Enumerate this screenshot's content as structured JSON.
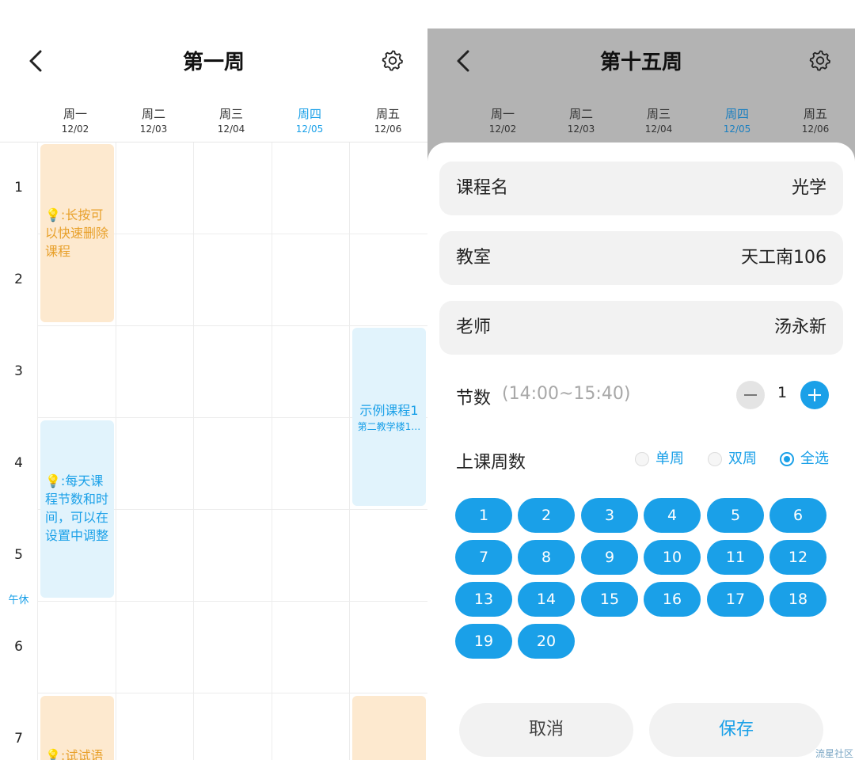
{
  "left": {
    "title": "第一周",
    "days": [
      {
        "name": "周一",
        "date": "12/02",
        "today": false
      },
      {
        "name": "周二",
        "date": "12/03",
        "today": false
      },
      {
        "name": "周三",
        "date": "12/04",
        "today": false
      },
      {
        "name": "周四",
        "date": "12/05",
        "today": true
      },
      {
        "name": "周五",
        "date": "12/06",
        "today": false
      }
    ],
    "sections": [
      "1",
      "2",
      "3",
      "4",
      "5",
      "6",
      "7"
    ],
    "noon_label": "午休",
    "cards": [
      {
        "text": "💡:长按可以快速删除课程",
        "color": "orange"
      },
      {
        "text": "💡:每天课程节数和时间，可以在设置中调整",
        "color": "blue"
      },
      {
        "text": "示例课程1",
        "subtext": "第二教学楼1…",
        "color": "blue"
      },
      {
        "text": "💡:试试语",
        "color": "orange"
      },
      {
        "text": "",
        "color": "orange"
      }
    ]
  },
  "right": {
    "title": "第十五周",
    "days": [
      {
        "name": "周一",
        "date": "12/02",
        "today": false
      },
      {
        "name": "周二",
        "date": "12/03",
        "today": false
      },
      {
        "name": "周三",
        "date": "12/04",
        "today": false
      },
      {
        "name": "周四",
        "date": "12/05",
        "today": true
      },
      {
        "name": "周五",
        "date": "12/06",
        "today": false
      }
    ],
    "form": {
      "course_label": "课程名",
      "course_value": "光学",
      "room_label": "教室",
      "room_value": "天工南106",
      "teacher_label": "老师",
      "teacher_value": "汤永新",
      "sections_label": "节数",
      "sections_time": "(14:00~15:40)",
      "sections_value": "1",
      "weeks_label": "上课周数",
      "radio_odd": "单周",
      "radio_even": "双周",
      "radio_all": "全选",
      "selected_radio": "全选",
      "weeks": [
        "1",
        "2",
        "3",
        "4",
        "5",
        "6",
        "7",
        "8",
        "9",
        "10",
        "11",
        "12",
        "13",
        "14",
        "15",
        "16",
        "17",
        "18",
        "19",
        "20"
      ],
      "cancel_label": "取消",
      "save_label": "保存"
    },
    "watermark": "流星社区"
  },
  "colors": {
    "accent": "#1aa0e8",
    "orange_card_bg": "#fde9cf",
    "orange_card_text": "#e8a02a",
    "blue_card_bg": "#e1f3fc",
    "overlay_gray": "#b3b3b3"
  }
}
